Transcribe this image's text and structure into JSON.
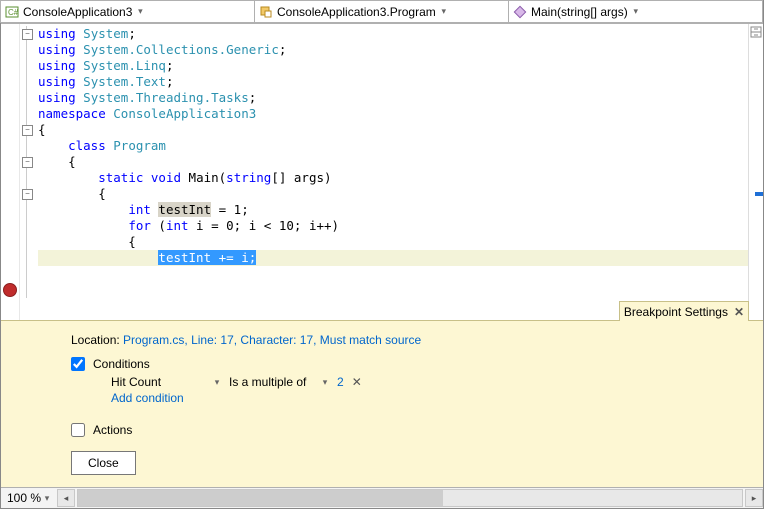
{
  "nav": {
    "scope": "ConsoleApplication3",
    "class": "ConsoleApplication3.Program",
    "member": "Main(string[] args)"
  },
  "code": {
    "lines": [
      {
        "fold": "-",
        "seg": [
          [
            "kw",
            "using"
          ],
          [
            "",
            " "
          ],
          [
            "tp",
            "System"
          ],
          [
            "",
            ";"
          ]
        ]
      },
      {
        "seg": [
          [
            "kw",
            "using"
          ],
          [
            "",
            " "
          ],
          [
            "tp",
            "System.Collections.Generic"
          ],
          [
            "",
            ";"
          ]
        ]
      },
      {
        "seg": [
          [
            "kw",
            "using"
          ],
          [
            "",
            " "
          ],
          [
            "tp",
            "System.Linq"
          ],
          [
            "",
            ";"
          ]
        ]
      },
      {
        "seg": [
          [
            "kw",
            "using"
          ],
          [
            "",
            " "
          ],
          [
            "tp",
            "System.Text"
          ],
          [
            "",
            ";"
          ]
        ]
      },
      {
        "seg": [
          [
            "kw",
            "using"
          ],
          [
            "",
            " "
          ],
          [
            "tp",
            "System.Threading.Tasks"
          ],
          [
            "",
            ";"
          ]
        ]
      },
      {
        "seg": [
          [
            "",
            ""
          ]
        ]
      },
      {
        "fold": "-",
        "seg": [
          [
            "kw",
            "namespace"
          ],
          [
            "",
            " "
          ],
          [
            "tp",
            "ConsoleApplication3"
          ]
        ]
      },
      {
        "seg": [
          [
            "",
            "{"
          ]
        ]
      },
      {
        "fold": "-",
        "seg": [
          [
            "",
            "    "
          ],
          [
            "kw",
            "class"
          ],
          [
            "",
            " "
          ],
          [
            "tp",
            "Program"
          ]
        ]
      },
      {
        "seg": [
          [
            "",
            "    {"
          ]
        ]
      },
      {
        "fold": "-",
        "seg": [
          [
            "",
            "        "
          ],
          [
            "kw",
            "static"
          ],
          [
            "",
            " "
          ],
          [
            "kw",
            "void"
          ],
          [
            "",
            " Main("
          ],
          [
            "kw",
            "string"
          ],
          [
            "",
            "[] args)"
          ]
        ]
      },
      {
        "seg": [
          [
            "",
            "        {"
          ]
        ]
      },
      {
        "seg": [
          [
            "",
            "            "
          ],
          [
            "kw",
            "int"
          ],
          [
            "",
            " "
          ],
          [
            "hl",
            "testInt"
          ],
          [
            "",
            " = 1;"
          ]
        ]
      },
      {
        "seg": [
          [
            "",
            ""
          ]
        ]
      },
      {
        "seg": [
          [
            "",
            "            "
          ],
          [
            "kw",
            "for"
          ],
          [
            "",
            " ("
          ],
          [
            "kw",
            "int"
          ],
          [
            "",
            " i = 0; i < 10; i++)"
          ]
        ]
      },
      {
        "seg": [
          [
            "",
            "            {"
          ]
        ]
      },
      {
        "bp": true,
        "seg": [
          [
            "",
            "                "
          ],
          [
            "sel",
            "testInt += i;"
          ]
        ]
      }
    ]
  },
  "bp": {
    "tab": "Breakpoint Settings",
    "location_label": "Location:",
    "location_value": "Program.cs, Line: 17, Character: 17, Must match source",
    "conditions_label": "Conditions",
    "conditions_checked": true,
    "cond_type": "Hit Count",
    "cond_op": "Is a multiple of",
    "cond_val": "2",
    "add_condition": "Add condition",
    "actions_label": "Actions",
    "actions_checked": false,
    "close": "Close"
  },
  "status": {
    "zoom": "100 %"
  }
}
